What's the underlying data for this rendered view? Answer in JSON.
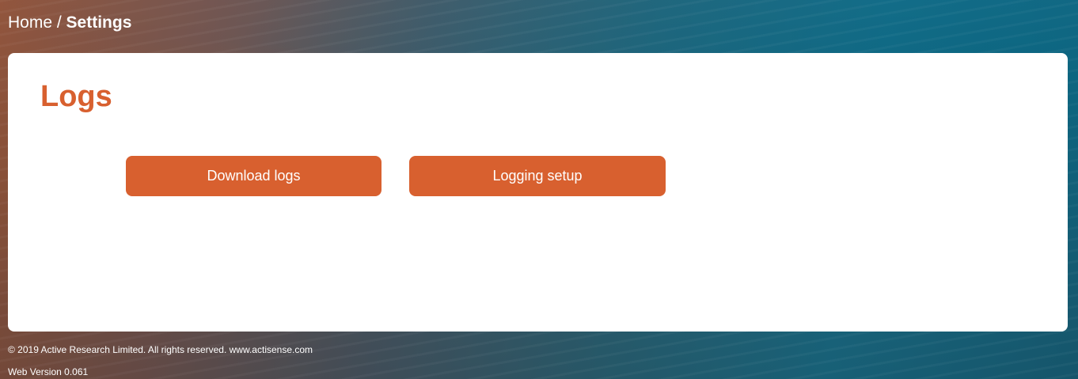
{
  "breadcrumb": {
    "home": "Home",
    "separator": " / ",
    "current": "Settings"
  },
  "main": {
    "title": "Logs",
    "buttons": [
      {
        "label": "Download logs"
      },
      {
        "label": "Logging setup"
      }
    ]
  },
  "footer": {
    "copyright": "© 2019 Active Research Limited. All rights reserved.  www.actisense.com",
    "version": "Web Version 0.061"
  },
  "colors": {
    "accent": "#d8602f",
    "card_background": "#ffffff",
    "text_on_background": "#ffffff"
  }
}
